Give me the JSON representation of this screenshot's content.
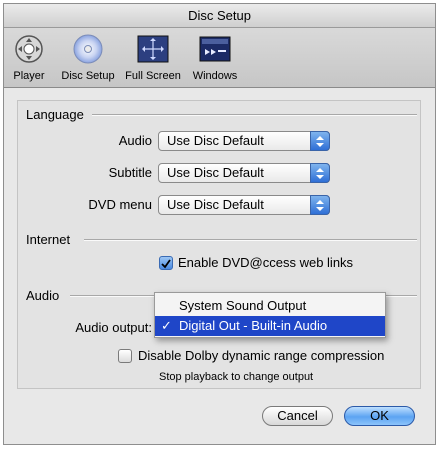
{
  "window": {
    "title": "Disc Setup"
  },
  "toolbar": {
    "items": [
      {
        "label": "Player",
        "icon": "player-icon"
      },
      {
        "label": "Disc Setup",
        "icon": "disc-icon"
      },
      {
        "label": "Full Screen",
        "icon": "full-screen-icon"
      },
      {
        "label": "Windows",
        "icon": "windows-icon"
      }
    ],
    "selected": "Disc Setup"
  },
  "language": {
    "title": "Language",
    "audio_label": "Audio",
    "audio_value": "Use Disc Default",
    "subtitle_label": "Subtitle",
    "subtitle_value": "Use Disc Default",
    "dvdmenu_label": "DVD menu",
    "dvdmenu_value": "Use Disc Default"
  },
  "internet": {
    "title": "Internet",
    "enable_label": "Enable DVD@ccess web links",
    "enable_checked": true
  },
  "audio": {
    "title": "Audio",
    "output_label": "Audio output:",
    "menu_options": [
      {
        "label": "System Sound Output",
        "selected": false
      },
      {
        "label": "Digital Out - Built-in Audio",
        "selected": true
      }
    ],
    "check_mark": "✓",
    "dolby_label": "Disable Dolby dynamic range compression",
    "dolby_checked": false,
    "note": "Stop playback to change output"
  },
  "buttons": {
    "cancel": "Cancel",
    "ok": "OK"
  },
  "colors": {
    "selection": "#1f46c8",
    "accent": "#4b8be0"
  }
}
